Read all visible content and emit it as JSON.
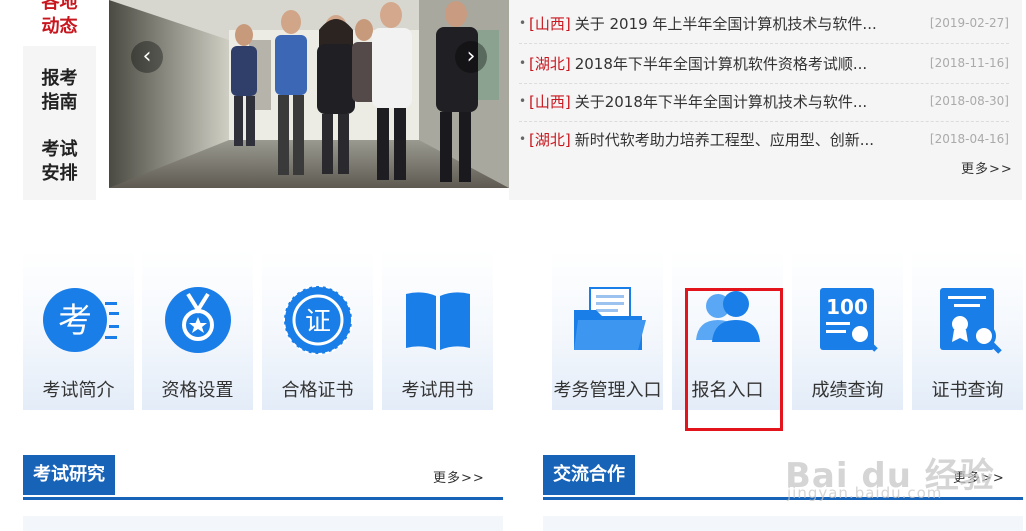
{
  "left_nav": {
    "items": [
      {
        "label": "各地动态",
        "active": true
      },
      {
        "label": "报考指南",
        "active": false
      },
      {
        "label": "考试安排",
        "active": false
      }
    ]
  },
  "carousel": {
    "prev_icon": "chevron-left-icon",
    "next_icon": "chevron-right-icon"
  },
  "news": {
    "items": [
      {
        "tag": "[山西]",
        "title": "关于 2019 年上半年全国计算机技术与软件...",
        "date": "[2019-02-27]"
      },
      {
        "tag": "[湖北]",
        "title": "2018年下半年全国计算机软件资格考试顺...",
        "date": "[2018-11-16]"
      },
      {
        "tag": "[山西]",
        "title": "关于2018年下半年全国计算机技术与软件...",
        "date": "[2018-08-30]"
      },
      {
        "tag": "[湖北]",
        "title": "新时代软考助力培养工程型、应用型、创新...",
        "date": "[2018-04-16]"
      }
    ],
    "more": "更多>>"
  },
  "tiles": [
    {
      "label": "考试简介",
      "icon": "exam-intro-icon"
    },
    {
      "label": "资格设置",
      "icon": "medal-icon"
    },
    {
      "label": "合格证书",
      "icon": "certificate-seal-icon"
    },
    {
      "label": "考试用书",
      "icon": "book-icon"
    },
    {
      "label": "考务管理入口",
      "icon": "folder-document-icon"
    },
    {
      "label": "报名入口",
      "icon": "users-icon"
    },
    {
      "label": "成绩查询",
      "icon": "score-search-icon"
    },
    {
      "label": "证书查询",
      "icon": "certificate-search-icon"
    }
  ],
  "sections": {
    "research": {
      "title": "考试研究",
      "more": "更多>>"
    },
    "exchange": {
      "title": "交流合作",
      "more": "更多>>"
    }
  },
  "colors": {
    "accent": "#1763b8",
    "red": "#c8161e",
    "icon_blue": "#1a7ee8",
    "highlight": "#e3141b"
  },
  "watermark": {
    "big": "Bai du 经验",
    "small": "jingyan.baidu.com"
  }
}
